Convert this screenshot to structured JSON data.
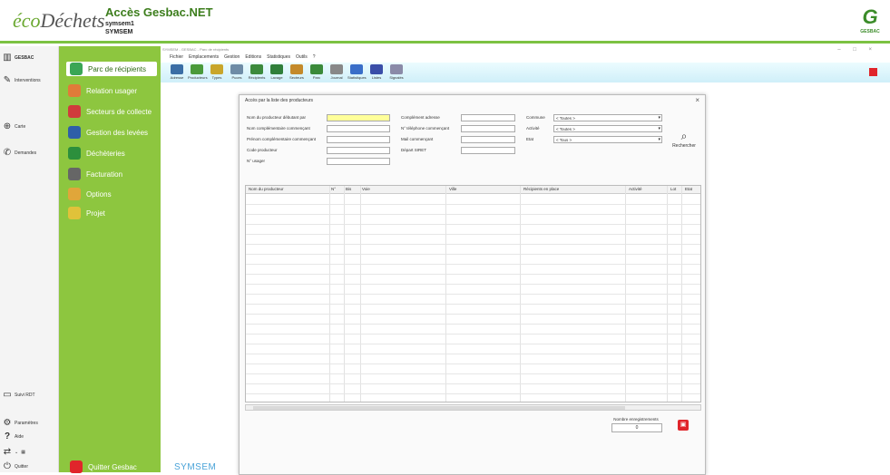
{
  "header": {
    "logo_prefix": "éco",
    "logo_suffix": "Déchets",
    "title": "Accès Gesbac.NET",
    "subtitle_line1": "symsem1",
    "subtitle_line2": "SYMSEM",
    "brand_logo": "GESBAC"
  },
  "rail": {
    "items": [
      {
        "label": "GESBAC",
        "icon": "trash-bin-icon"
      },
      {
        "label": "Interventions",
        "icon": "pen-icon"
      },
      {
        "label": "Carte",
        "icon": "globe-icon"
      },
      {
        "label": "Demandes",
        "icon": "phone-icon"
      },
      {
        "label": "Suivi RDT",
        "icon": "truck-icon"
      },
      {
        "label": "Paramètres",
        "icon": "gear-icon"
      },
      {
        "label": "Aide",
        "icon": "help-icon"
      },
      {
        "label": "Quitter",
        "icon": "power-icon"
      }
    ]
  },
  "nav": {
    "items": [
      {
        "label": "Parc de récipients",
        "color": "#3aa655"
      },
      {
        "label": "Relation usager",
        "color": "#e07b39"
      },
      {
        "label": "Secteurs de collecte",
        "color": "#d03c3c"
      },
      {
        "label": "Gestion des levées",
        "color": "#2e5fa8"
      },
      {
        "label": "Déchèteries",
        "color": "#2c8f3c"
      },
      {
        "label": "Facturation",
        "color": "#666666"
      },
      {
        "label": "Options",
        "color": "#e0a63a"
      },
      {
        "label": "Projet",
        "color": "#e0c23a"
      }
    ],
    "bottom_label": "Quitter Gesbac"
  },
  "main": {
    "title": "SYMSEM - GESBAC - Parc de récipients",
    "menu": [
      "Fichier",
      "Emplacements",
      "Gestion",
      "Editions",
      "Statistiques",
      "Outils",
      "?"
    ],
    "toolbar": [
      "Adresse",
      "Producteurs",
      "Types",
      "Puces",
      "Récipients",
      "Lavage",
      "Secteurs",
      "Parc",
      "Journal",
      "Statistiques",
      "Listes",
      "Signalés"
    ]
  },
  "dialog": {
    "title": "Accès par la liste des producteurs",
    "labels": {
      "nom_producteur": "Nom du producteur débutant par",
      "nom_complementaire": "Nom complémentaire commençant",
      "prenom": "Prénom complémentaire commençant",
      "code_producteur": "Code producteur",
      "n_usager": "N° usager",
      "complement_adresse": "Complément adresse",
      "telephone": "N° téléphone commençant",
      "mail": "Mail commençant",
      "siret": "Départ SIRET",
      "commune": "Commune",
      "activite": "Activité",
      "etat": "Etat"
    },
    "selects": {
      "commune": "< Toutes >",
      "activite": "< Toutes >",
      "etat": "< Tous >"
    },
    "search_label": "Rechercher",
    "columns": [
      "Nom du producteur",
      "N°",
      "Bis",
      "Voie",
      "Ville",
      "Récipients en place",
      "Activité",
      "Lot",
      "Etat"
    ],
    "count_label": "Nombre enregistrements",
    "count_value": "0"
  },
  "footer": {
    "brand": "SYMSEM"
  }
}
